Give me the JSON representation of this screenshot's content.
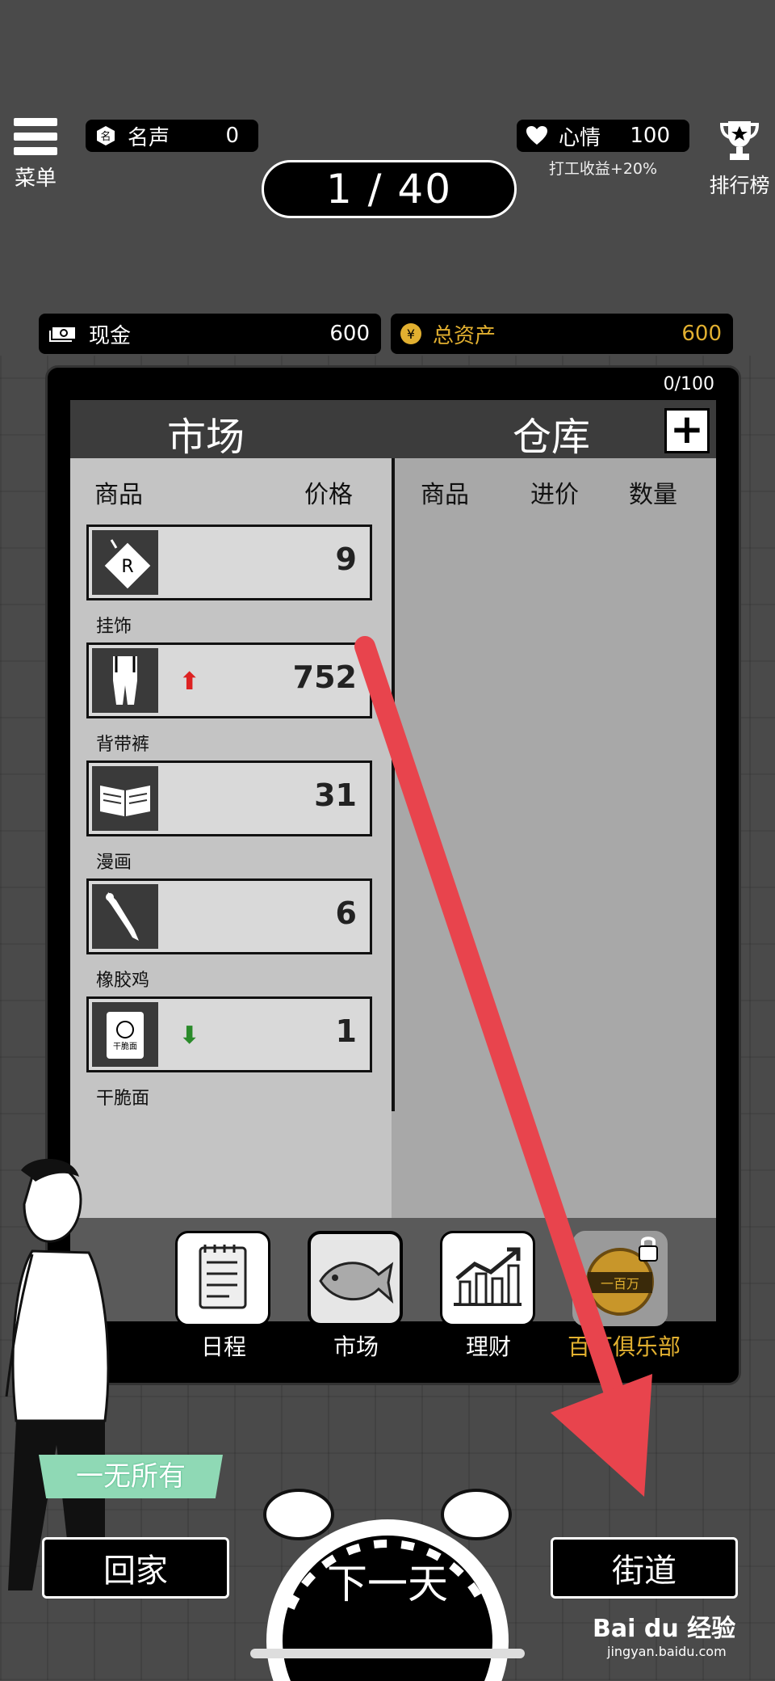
{
  "top_bar": {
    "menu_label": "菜单",
    "fame_label": "名声",
    "fame_value": "0",
    "mood_label": "心情",
    "mood_value": "100",
    "mood_note": "打工收益+20%",
    "rank_label": "排行榜",
    "day_counter": "1 / 40"
  },
  "money": {
    "cash_label": "现金",
    "cash_value": "600",
    "assets_label": "总资产",
    "assets_value": "600"
  },
  "panel": {
    "capacity": "0/100",
    "tab_market": "市场",
    "tab_warehouse": "仓库",
    "plus_symbol": "+",
    "market_headers": [
      "商品",
      "价格"
    ],
    "warehouse_headers": [
      "商品",
      "进价",
      "数量"
    ],
    "market_items": [
      {
        "name": "挂饰",
        "price": "9",
        "trend": ""
      },
      {
        "name": "背带裤",
        "price": "752",
        "trend": "up"
      },
      {
        "name": "漫画",
        "price": "31",
        "trend": ""
      },
      {
        "name": "橡胶鸡",
        "price": "6",
        "trend": ""
      },
      {
        "name": "干脆面",
        "price": "1",
        "trend": "down"
      }
    ],
    "thumb_text": "干脆面",
    "nav": [
      {
        "label": "日程"
      },
      {
        "label": "市场"
      },
      {
        "label": "理财"
      },
      {
        "label": "百万俱乐部",
        "locked": true,
        "badge": "一百万"
      }
    ]
  },
  "bottom": {
    "status_tag": "一无所有",
    "go_home": "回家",
    "next_day": "下一天",
    "street": "街道"
  },
  "watermark": {
    "brand": "Bai du 经验",
    "url": "jingyan.baidu.com"
  },
  "colors": {
    "background": "#4a4a4a",
    "assets_gold": "#e2b030",
    "arrow_red": "#e8444d",
    "up_red": "#d22",
    "down_green": "#2a8a2a",
    "status_green": "#8fd9b5"
  }
}
